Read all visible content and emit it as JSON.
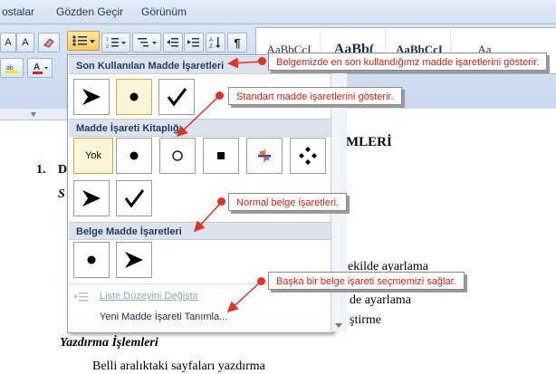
{
  "menu_tabs": [
    "ostalar",
    "Gözden Geçir",
    "Görünüm"
  ],
  "styles_samples": [
    "AaBbCcI",
    "AaBb(",
    "AaBbCcI",
    "Aa"
  ],
  "panel": {
    "recent_header": "Son Kullanılan Madde İşaretleri",
    "library_header": "Madde İşareti Kitaplığı",
    "library_none_label": "Yok",
    "document_header": "Belge Madde İşaretleri",
    "change_level_label": "Liste Düzeyini Değiştir",
    "define_new_label": "Yeni Madde İşareti Tanımla..."
  },
  "callouts": {
    "recent": "Belgemizde en son kullandığımz madde işaretlerini gösterir.",
    "standard": "Standart madde işaretlerini gösterir.",
    "normal": "Normal belge işaretleri.",
    "other": "Başka bir belge işareti seçmemizi sağlar."
  },
  "document": {
    "heading_fragment": "MLERİ",
    "list_number": "1.",
    "list_letter": "D",
    "italic_letter": "S",
    "line1_fragment": "ekilde ayarlama",
    "line2_fragment": "de ayarlama",
    "line3_fragment": "ştirme",
    "section_title": "Yazdırma İşlemleri",
    "body_line": "Belli aralıktaki  sayfaları yazdırma"
  },
  "colors": {
    "callout_text": "#e1200f",
    "arrow": "#e5311f",
    "selection_border": "#e3a73d"
  }
}
